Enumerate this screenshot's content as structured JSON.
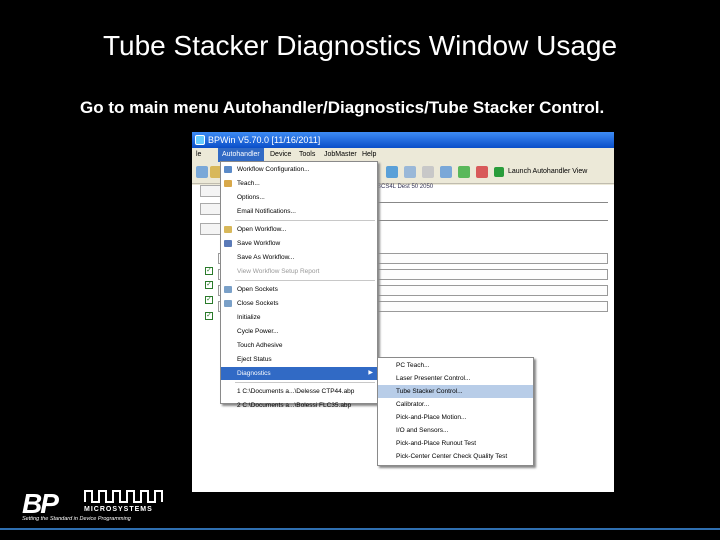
{
  "slide": {
    "title": "Tube Stacker Diagnostics Window Usage",
    "instruction": "Go to main menu Autohandler/Diagnostics/Tube Stacker Control."
  },
  "window": {
    "title": "BPWin V5.70.0 [11/16/2011]",
    "menus": [
      "le",
      "Autohandler",
      "Device",
      "Tools",
      "JobMaster",
      "Help"
    ],
    "active_menu": "Autohandler",
    "toolbar_launch": "Launch Autohandler View",
    "content_fragment": "BCS4L  Dest 50 2050"
  },
  "autohandler_menu": {
    "items": [
      {
        "label": "Workflow Configuration...",
        "disabled": false
      },
      {
        "label": "Teach...",
        "disabled": false
      },
      {
        "label": "Options...",
        "disabled": false
      },
      {
        "label": "Email Notifications...",
        "disabled": false
      },
      {
        "label": "Open Workflow...",
        "disabled": false
      },
      {
        "label": "Save Workflow",
        "disabled": false
      },
      {
        "label": "Save As Workflow...",
        "disabled": false
      },
      {
        "label": "View Workflow Setup Report",
        "disabled": true
      },
      {
        "label": "Open Sockets",
        "disabled": false
      },
      {
        "label": "Close Sockets",
        "disabled": false
      },
      {
        "label": "Initialize",
        "disabled": false
      },
      {
        "label": "Cycle Power...",
        "disabled": false
      },
      {
        "label": "Touch Adhesive",
        "disabled": false
      },
      {
        "label": "Eject Status",
        "disabled": false
      },
      {
        "label": "Diagnostics",
        "disabled": false
      },
      {
        "label": "1 C:\\Documents a...\\Delesse CTP44.abp",
        "disabled": false
      },
      {
        "label": "2 C:\\Documents a...\\Bolessi FLC35.abp",
        "disabled": false
      }
    ]
  },
  "diagnostics_menu": {
    "items": [
      "PC Teach...",
      "Laser Presenter Control...",
      "Tube Stacker Control...",
      "Calibrator...",
      "Pick-and-Place Motion...",
      "I/O and Sensors...",
      "Pick-and-Place Runout Test",
      "Pick-Center Center Check Quality Test"
    ],
    "highlighted": "Tube Stacker Control..."
  },
  "logo": {
    "brand": "BP",
    "subbrand": "MICROSYSTEMS",
    "tagline": "Setting the Standard in Device Programming"
  },
  "colors": {
    "background": "#000000",
    "menu_highlight": "#316ac5",
    "submenu_highlight": "#b8cde8",
    "rule": "#2f6fb0"
  }
}
